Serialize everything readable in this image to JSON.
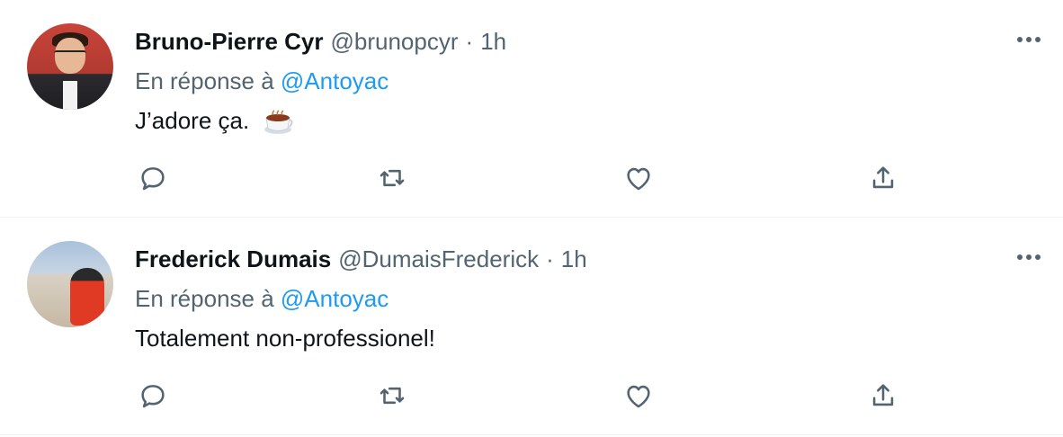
{
  "tweets": [
    {
      "name": "Bruno-Pierre Cyr",
      "handle": "@brunopcyr",
      "separator": "·",
      "time": "1h",
      "reply_prefix": "En réponse à",
      "reply_to": "@Antoyac",
      "text": "J’adore ça.",
      "emoji": "hot-beverage-icon"
    },
    {
      "name": "Frederick Dumais",
      "handle": "@DumaisFrederick",
      "separator": "·",
      "time": "1h",
      "reply_prefix": "En réponse à",
      "reply_to": "@Antoyac",
      "text": "Totalement non-professionel!"
    }
  ],
  "icons": {
    "more": "more-horizontal-icon",
    "reply": "reply-icon",
    "retweet": "retweet-icon",
    "like": "like-icon",
    "share": "share-icon"
  },
  "colors": {
    "text": "#0f1419",
    "secondary": "#536471",
    "link": "#1d9bf0",
    "divider": "#eff3f4"
  }
}
